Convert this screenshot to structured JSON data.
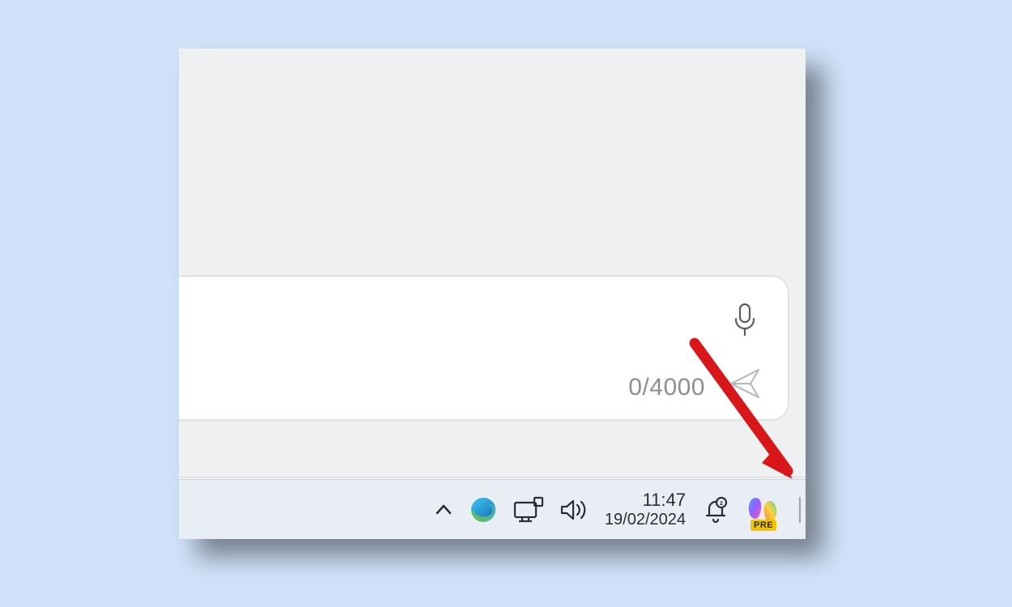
{
  "input": {
    "char_counter": "0/4000"
  },
  "taskbar": {
    "time": "11:47",
    "date": "19/02/2024",
    "copilot_badge": "PRE"
  }
}
